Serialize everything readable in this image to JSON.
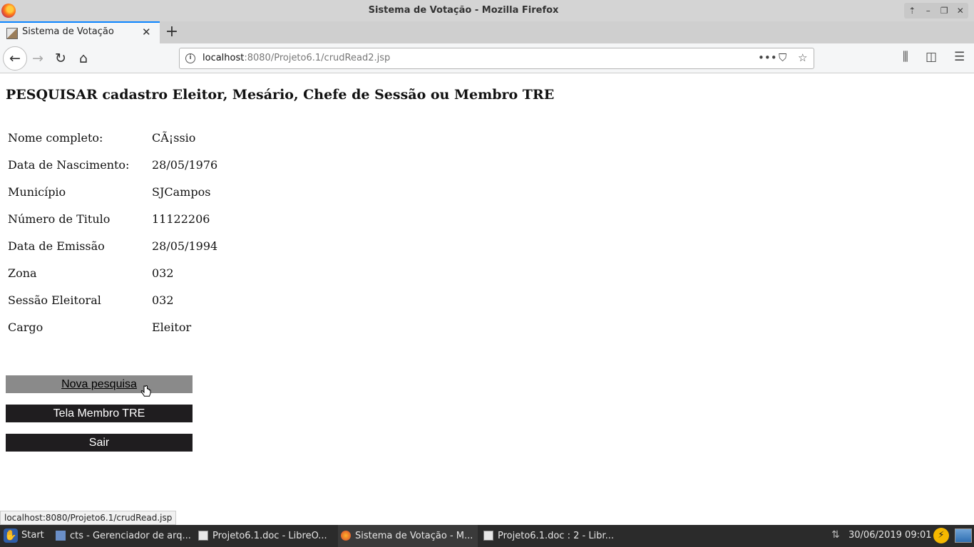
{
  "window": {
    "title": "Sistema de Votação - Mozilla Firefox"
  },
  "browser": {
    "tab_title": "Sistema de Votação",
    "url_host": "localhost",
    "url_rest": ":8080/Projeto6.1/crudRead2.jsp",
    "status_link": "localhost:8080/Projeto6.1/crudRead.jsp"
  },
  "page": {
    "heading": "PESQUISAR cadastro Eleitor, Mesário, Chefe de Sessão ou Membro TRE",
    "fields": [
      {
        "label": "Nome completo:",
        "value": "CÃ¡ssio"
      },
      {
        "label": "Data de Nascimento:",
        "value": "28/05/1976"
      },
      {
        "label": "Município",
        "value": "SJCampos"
      },
      {
        "label": "Número de Titulo",
        "value": "11122206"
      },
      {
        "label": "Data de Emissão",
        "value": "28/05/1994"
      },
      {
        "label": "Zona",
        "value": "032"
      },
      {
        "label": "Sessão Eleitoral",
        "value": "032"
      },
      {
        "label": "Cargo",
        "value": "Eleitor"
      }
    ],
    "buttons": {
      "nova_pesquisa": "Nova pesquisa",
      "tela_membro": "Tela Membro TRE",
      "sair": "Sair"
    }
  },
  "taskbar": {
    "start": "Start",
    "tasks": [
      "cts - Gerenciador de arq...",
      "Projeto6.1.doc - LibreO...",
      "Sistema de Votação - M...",
      "Projeto6.1.doc : 2 - Libr..."
    ],
    "clock": "30/06/2019 09:01"
  },
  "icons": {
    "back": "back-arrow-icon",
    "forward": "forward-arrow-icon",
    "reload": "reload-icon",
    "home": "home-icon",
    "page_actions": "more-icon",
    "pocket": "pocket-icon",
    "bookmark": "star-icon",
    "library": "library-icon",
    "sidebar": "sidebar-icon",
    "menu": "hamburger-icon"
  }
}
